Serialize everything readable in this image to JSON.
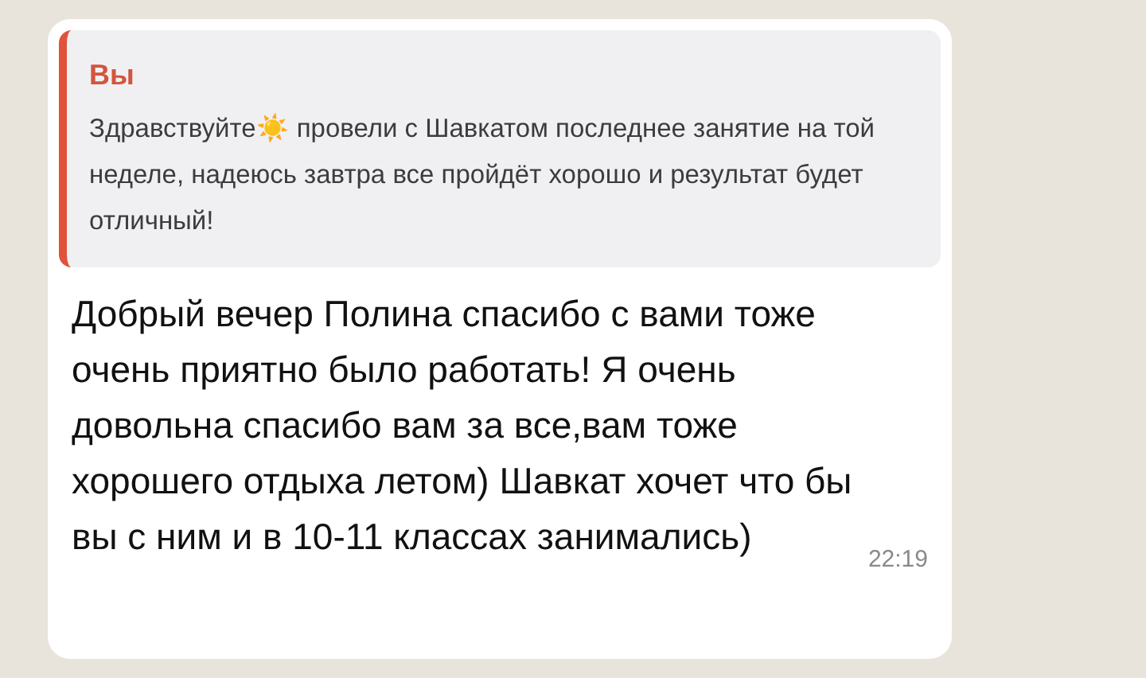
{
  "message": {
    "quote": {
      "author": "Вы",
      "text": "Здравствуйте☀️ провели с Шавкатом  последнее занятие на той неделе, надеюсь завтра все пройдёт хорошо и результат будет отличный!"
    },
    "text": "Добрый вечер Полина спасибо с вами тоже очень приятно было работать! Я очень довольна спасибо вам за все,вам тоже хорошего отдыха летом) Шавкат хочет  что бы вы с ним и в 10-11 классах занимались)",
    "time": "22:19"
  }
}
